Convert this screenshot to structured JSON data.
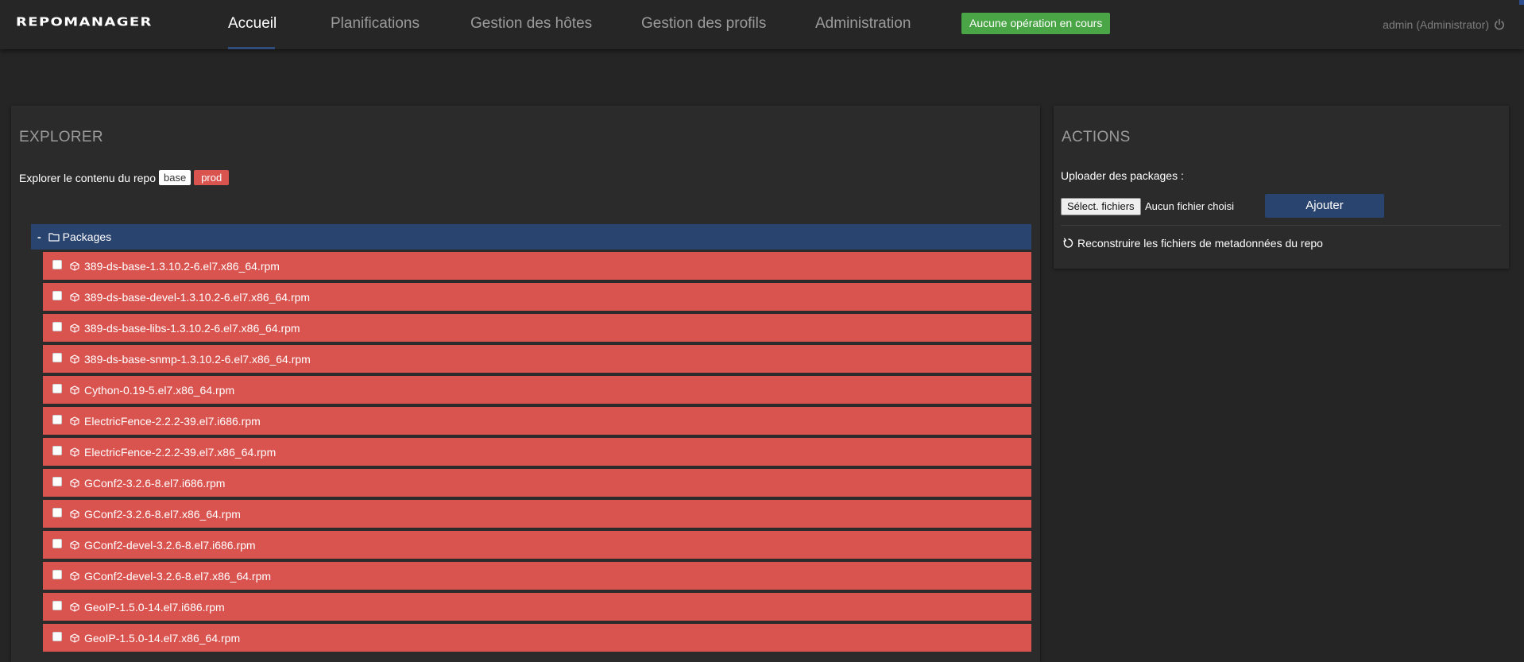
{
  "header": {
    "logo": "REPOMANAGER",
    "nav": [
      {
        "label": "Accueil"
      },
      {
        "label": "Planifications"
      },
      {
        "label": "Gestion des hôtes"
      },
      {
        "label": "Gestion des profils"
      },
      {
        "label": "Administration"
      }
    ],
    "operation_badge": "Aucune opération en cours",
    "user": "admin (Administrator)",
    "icons": {
      "power": "power-icon"
    }
  },
  "explorer": {
    "title": "EXPLORER",
    "explore_text": "Explorer le contenu du repo",
    "repo_name": "base",
    "repo_env": "prod",
    "folder": {
      "toggle": "-",
      "label": "Packages",
      "icon": "folder-icon"
    },
    "packages": [
      "389-ds-base-1.3.10.2-6.el7.x86_64.rpm",
      "389-ds-base-devel-1.3.10.2-6.el7.x86_64.rpm",
      "389-ds-base-libs-1.3.10.2-6.el7.x86_64.rpm",
      "389-ds-base-snmp-1.3.10.2-6.el7.x86_64.rpm",
      "Cython-0.19-5.el7.x86_64.rpm",
      "ElectricFence-2.2.2-39.el7.i686.rpm",
      "ElectricFence-2.2.2-39.el7.x86_64.rpm",
      "GConf2-3.2.6-8.el7.i686.rpm",
      "GConf2-3.2.6-8.el7.x86_64.rpm",
      "GConf2-devel-3.2.6-8.el7.i686.rpm",
      "GConf2-devel-3.2.6-8.el7.x86_64.rpm",
      "GeoIP-1.5.0-14.el7.i686.rpm",
      "GeoIP-1.5.0-14.el7.x86_64.rpm"
    ],
    "colors": {
      "package_row": "#d9534f",
      "folder_row": "#2a4470"
    }
  },
  "actions": {
    "title": "ACTIONS",
    "upload_label": "Uploader des packages :",
    "file_button": "Sélect. fichiers",
    "file_status": "Aucun fichier choisi",
    "add_button": "Ajouter",
    "rebuild_label": "Reconstruire les fichiers de metadonnées du repo",
    "icons": {
      "rebuild": "refresh-icon"
    }
  }
}
